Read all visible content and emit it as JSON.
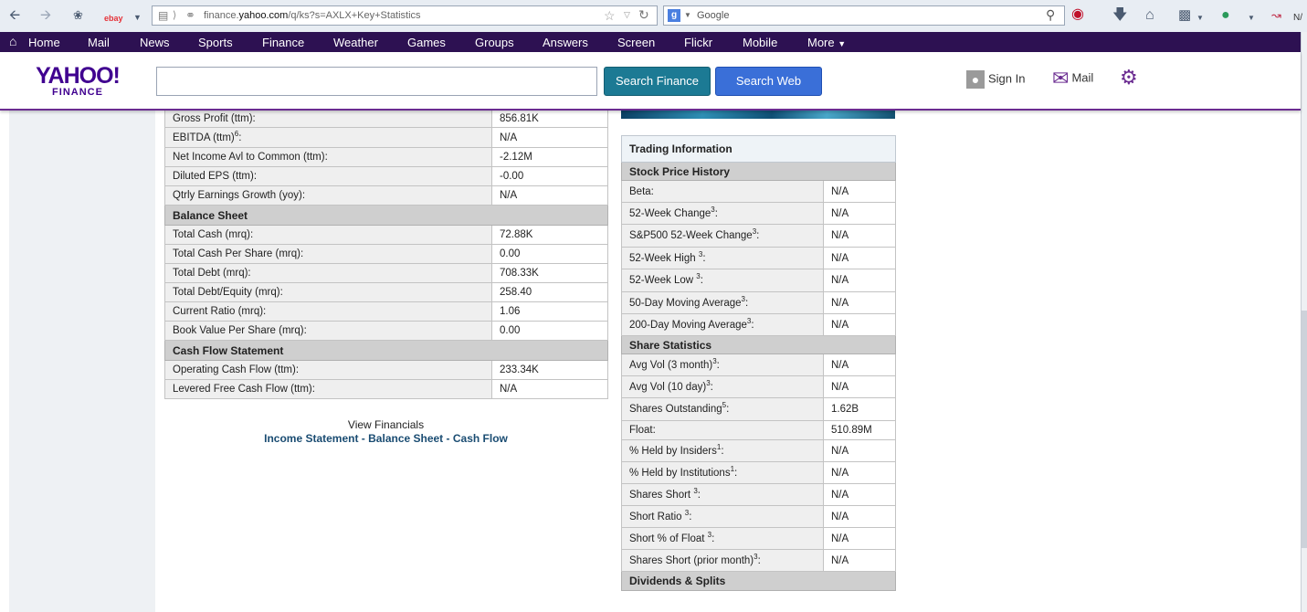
{
  "browser": {
    "url_domain_prefix": "finance.",
    "url_domain": "yahoo.com",
    "url_path": "/q/ks?s=AXLX+Key+Statistics",
    "search_placeholder": "Google",
    "bookmark_label": "ebay",
    "overflow_label": "N/"
  },
  "nav": {
    "items": [
      "Home",
      "Mail",
      "News",
      "Sports",
      "Finance",
      "Weather",
      "Games",
      "Groups",
      "Answers",
      "Screen",
      "Flickr",
      "Mobile",
      "More"
    ]
  },
  "header": {
    "logo_main": "YAHOO!",
    "logo_sub": "FINANCE",
    "search_value": "",
    "search_finance_label": "Search Finance",
    "search_web_label": "Search Web",
    "signin_label": "Sign In",
    "mail_label": "Mail"
  },
  "left_table": {
    "rows": [
      {
        "label": "Gross Profit (ttm):",
        "value": "856.81K"
      },
      {
        "label": "EBITDA (ttm)",
        "sup": "6",
        "suffix": ":",
        "value": "N/A"
      },
      {
        "label": "Net Income Avl to Common (ttm):",
        "value": "-2.12M"
      },
      {
        "label": "Diluted EPS (ttm):",
        "value": "-0.00"
      },
      {
        "label": "Qtrly Earnings Growth (yoy):",
        "value": "N/A"
      },
      {
        "section": "Balance Sheet"
      },
      {
        "label": "Total Cash (mrq):",
        "value": "72.88K"
      },
      {
        "label": "Total Cash Per Share (mrq):",
        "value": "0.00"
      },
      {
        "label": "Total Debt (mrq):",
        "value": "708.33K"
      },
      {
        "label": "Total Debt/Equity (mrq):",
        "value": "258.40"
      },
      {
        "label": "Current Ratio (mrq):",
        "value": "1.06"
      },
      {
        "label": "Book Value Per Share (mrq):",
        "value": "0.00"
      },
      {
        "section": "Cash Flow Statement"
      },
      {
        "label": "Operating Cash Flow (ttm):",
        "value": "233.34K"
      },
      {
        "label": "Levered Free Cash Flow (ttm):",
        "value": "N/A"
      }
    ]
  },
  "view_financials": {
    "label": "View Financials",
    "links": [
      "Income Statement",
      "Balance Sheet",
      "Cash Flow"
    ],
    "separator": " - "
  },
  "right_table": {
    "title": "Trading Information",
    "rows": [
      {
        "section": "Stock Price History"
      },
      {
        "label": "Beta:",
        "value": "N/A"
      },
      {
        "label": "52-Week Change",
        "sup": "3",
        "suffix": ":",
        "value": "N/A"
      },
      {
        "label": "S&P500 52-Week Change",
        "sup": "3",
        "suffix": ":",
        "value": "N/A"
      },
      {
        "label": "52-Week High ",
        "sup": "3",
        "suffix": ":",
        "value": "N/A"
      },
      {
        "label": "52-Week Low ",
        "sup": "3",
        "suffix": ":",
        "value": "N/A"
      },
      {
        "label": "50-Day Moving Average",
        "sup": "3",
        "suffix": ":",
        "value": "N/A"
      },
      {
        "label": "200-Day Moving Average",
        "sup": "3",
        "suffix": ":",
        "value": "N/A"
      },
      {
        "section": "Share Statistics"
      },
      {
        "label": "Avg Vol (3 month)",
        "sup": "3",
        "suffix": ":",
        "value": "N/A"
      },
      {
        "label": "Avg Vol (10 day)",
        "sup": "3",
        "suffix": ":",
        "value": "N/A"
      },
      {
        "label": "Shares Outstanding",
        "sup": "5",
        "suffix": ":",
        "value": "1.62B"
      },
      {
        "label": "Float:",
        "value": "510.89M"
      },
      {
        "label": "% Held by Insiders",
        "sup": "1",
        "suffix": ":",
        "value": "N/A"
      },
      {
        "label": "% Held by Institutions",
        "sup": "1",
        "suffix": ":",
        "value": "N/A"
      },
      {
        "label": "Shares Short ",
        "sup": "3",
        "suffix": ":",
        "value": "N/A"
      },
      {
        "label": "Short Ratio ",
        "sup": "3",
        "suffix": ":",
        "value": "N/A"
      },
      {
        "label": "Short % of Float ",
        "sup": "3",
        "suffix": ":",
        "value": "N/A"
      },
      {
        "label": "Shares Short (prior month)",
        "sup": "3",
        "suffix": ":",
        "value": "N/A"
      },
      {
        "section": "Dividends & Splits"
      }
    ]
  },
  "colors": {
    "nav_bg": "#2d1152",
    "brand_purple": "#400090",
    "finance_button": "#1c7a94",
    "web_button": "#3a6fd8",
    "section_bg": "#cfcfcf",
    "link": "#1a4c72"
  }
}
